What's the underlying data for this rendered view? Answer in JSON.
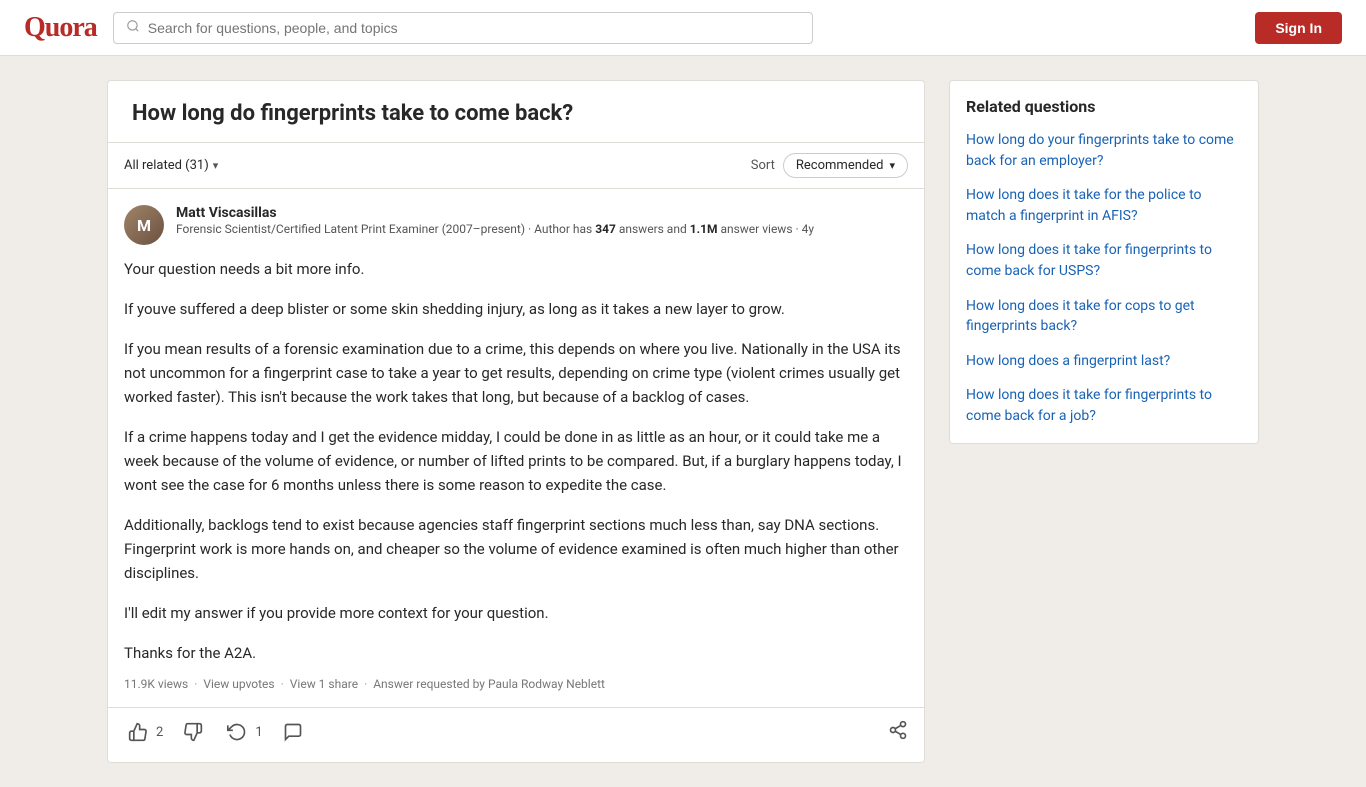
{
  "header": {
    "logo": "Quora",
    "search_placeholder": "Search for questions, people, and topics",
    "sign_in_label": "Sign In"
  },
  "question": {
    "title": "How long do fingerprints take to come back?",
    "filter_label": "All related (31)",
    "sort_label": "Sort",
    "sort_option": "Recommended"
  },
  "answer": {
    "author_name": "Matt Viscasillas",
    "author_bio_prefix": "Forensic Scientist/Certified Latent Print Examiner (2007–present) · Author has ",
    "author_answers": "347",
    "author_bio_mid": " answers and ",
    "author_views": "1.1M",
    "author_bio_suffix": " answer views · 4y",
    "paragraphs": [
      "Your question needs a bit more info.",
      "If youve suffered a deep blister or some skin shedding injury, as long as it takes a new layer to grow.",
      "If you mean results of a forensic examination due to a crime, this depends on where you live. Nationally in the USA its not uncommon for a fingerprint case to take a year to get results, depending on crime type (violent crimes usually get worked faster). This isn't because the work takes that long, but because of a backlog of cases.",
      "If a crime happens today and I get the evidence midday, I could be done in as little as an hour, or it could take me a week because of the volume of evidence, or number of lifted prints to be compared. But, if a burglary happens today, I wont see the case for 6 months unless there is some reason to expedite the case.",
      "Additionally, backlogs tend to exist because agencies staff fingerprint sections much less than, say DNA sections. Fingerprint work is more hands on, and cheaper so the volume of evidence examined is often much higher than other disciplines.",
      "I'll edit my answer if you provide more context for your question.",
      "Thanks for the A2A."
    ],
    "footer_views": "11.9K views",
    "footer_upvotes": "View upvotes",
    "footer_share": "View 1 share",
    "footer_requested": "Answer requested by Paula Rodway Neblett",
    "upvote_count": "2",
    "redo_count": "1"
  },
  "related": {
    "title": "Related questions",
    "items": [
      "How long do your fingerprints take to come back for an employer?",
      "How long does it take for the police to match a fingerprint in AFIS?",
      "How long does it take for fingerprints to come back for USPS?",
      "How long does it take for cops to get fingerprints back?",
      "How long does a fingerprint last?",
      "How long does it take for fingerprints to come back for a job?"
    ]
  }
}
